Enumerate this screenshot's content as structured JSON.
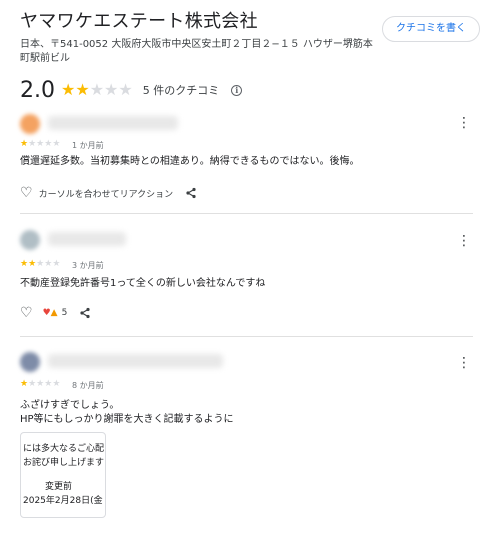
{
  "business": {
    "name": "ヤマワケエステート株式会社",
    "address": "日本、〒541-0052 大阪府大阪市中央区安土町２丁目２−１５ ハウザー堺筋本町駅前ビル",
    "write_review_label": "クチコミを書く",
    "rating_value": "2.0",
    "rating": 2,
    "review_count_label": "5 件のクチコミ"
  },
  "reviews": [
    {
      "rating": 1,
      "time": "1 か月前",
      "text": "償還遅延多数。当初募集時との相違あり。納得できるものではない。後悔。",
      "reaction_label": "カーソルを合わせてリアクション"
    },
    {
      "rating": 2,
      "time": "3 か月前",
      "text": "不動産登録免許番号1って全くの新しい会社なんですね",
      "reaction_count": "5"
    },
    {
      "rating": 1,
      "time": "8 か月前",
      "text_line1": "ふざけすぎでしょう。",
      "text_line2": "HP等にもしっかり謝罪を大きく記載するように",
      "photo": {
        "line1": "には多大なるご心配",
        "line2": "お詫び申し上げます",
        "line3": "変更前",
        "line4": "2025年2月28日(金"
      }
    }
  ],
  "colors": {
    "star_on": "#fbbc04",
    "star_off": "#dadce0",
    "accent": "#1a73e8"
  },
  "icons": {
    "more": "more-vert-icon",
    "heart": "heart-outline-icon",
    "share": "share-icon",
    "info": "info-icon"
  }
}
